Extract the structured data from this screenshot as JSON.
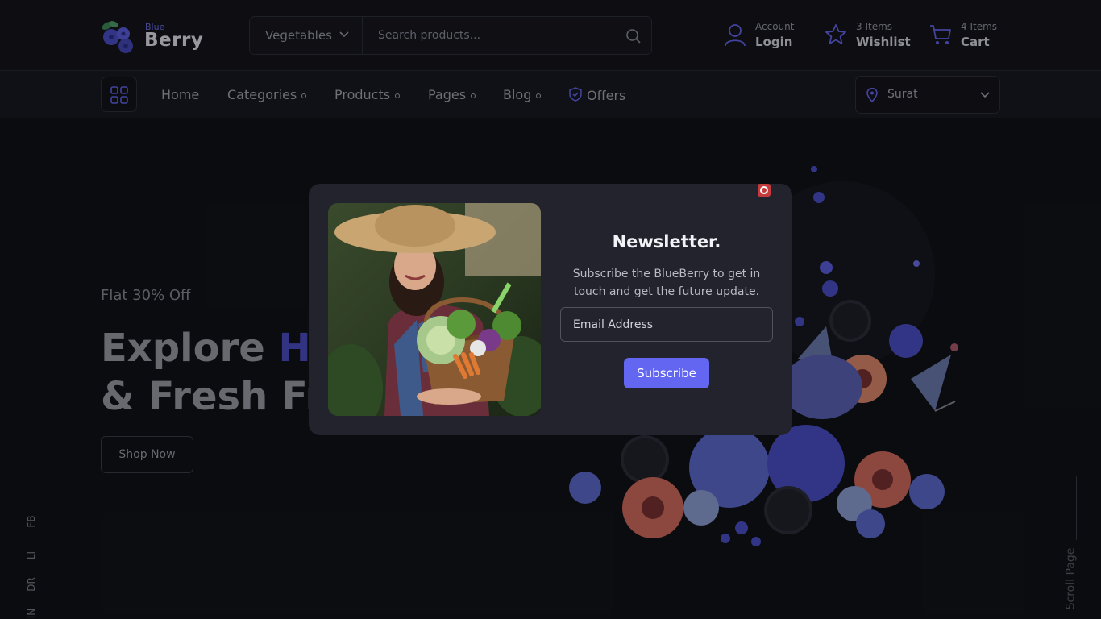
{
  "brand": {
    "name_small": "Blue",
    "name_big": "Berry",
    "accent_color": "#6366f1"
  },
  "search": {
    "category": "Vegetables",
    "placeholder": "Search products..."
  },
  "header": {
    "account": {
      "small": "Account",
      "big": "Login",
      "icon": "user-icon"
    },
    "wishlist": {
      "small": "3 Items",
      "big": "Wishlist",
      "icon": "star-icon"
    },
    "cart": {
      "small": "4 Items",
      "big": "Cart",
      "icon": "cart-icon"
    }
  },
  "nav": {
    "items": [
      {
        "label": "Home"
      },
      {
        "label": "Categories"
      },
      {
        "label": "Products"
      },
      {
        "label": "Pages"
      },
      {
        "label": "Blog"
      },
      {
        "label": "Offers"
      }
    ],
    "location": "Surat"
  },
  "hero": {
    "offer": "Flat 30% Off",
    "title_part1": "Explore ",
    "title_accent": "He",
    "title_line2": "& Fresh Fru",
    "button": "Shop Now"
  },
  "social": {
    "fb": "FB",
    "li": "LI",
    "dr": "DR",
    "in": "IN"
  },
  "scroll_label": "Scroll Page",
  "newsletter": {
    "title": "Newsletter.",
    "text": "Subscribe the BlueBerry to get in touch and get the future update.",
    "email_placeholder": "Email Address",
    "button": "Subscribe"
  }
}
